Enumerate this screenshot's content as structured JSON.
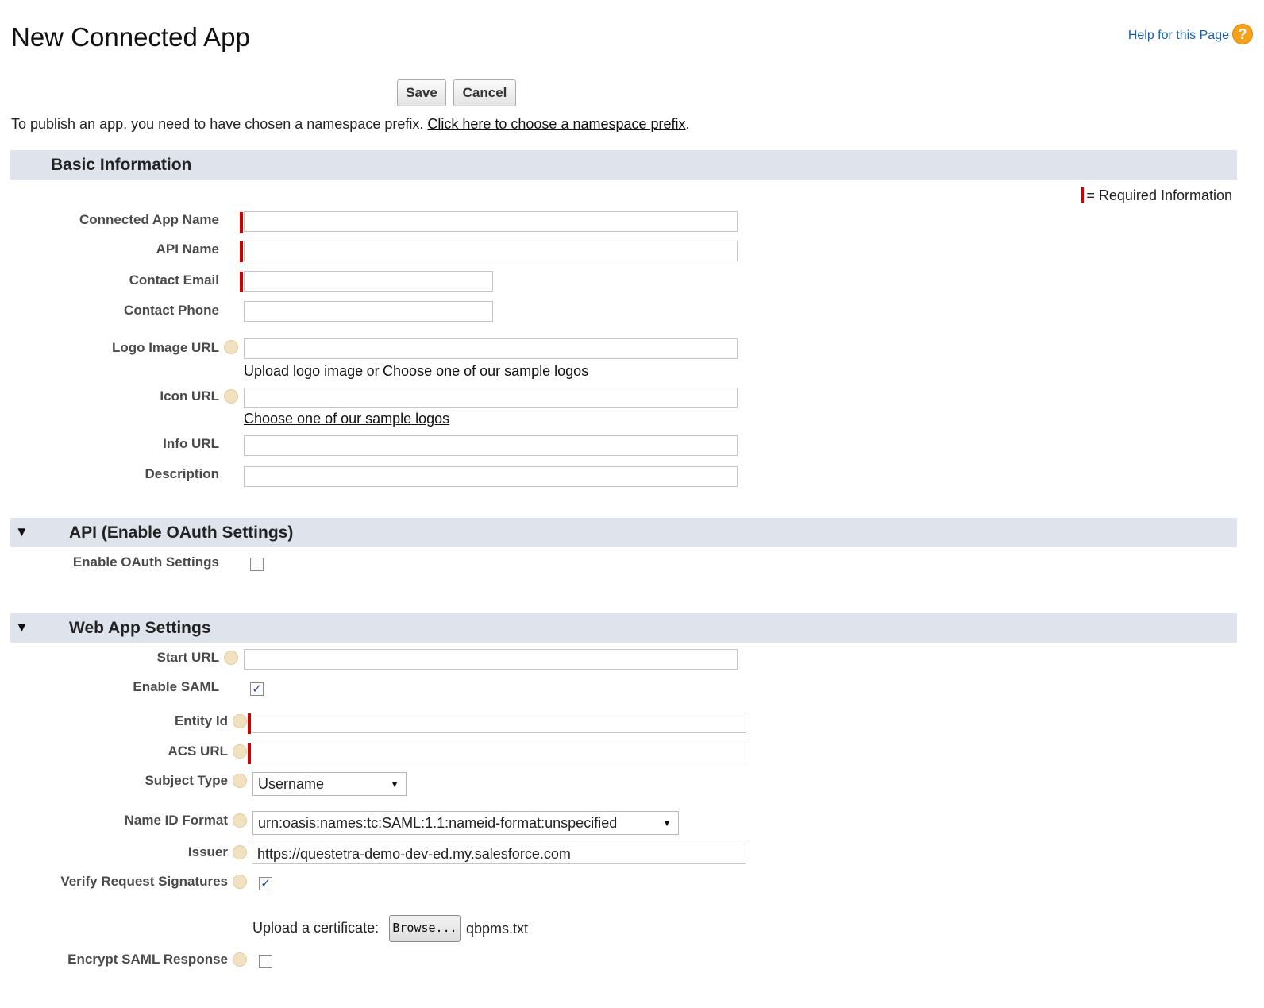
{
  "page": {
    "title": "New Connected App",
    "help_link": "Help for this Page",
    "help_icon": "?"
  },
  "toolbar": {
    "save": "Save",
    "cancel": "Cancel"
  },
  "notice": {
    "text": "To publish an app, you need to have chosen a namespace prefix. ",
    "link": "Click here to choose a namespace prefix",
    "end": "."
  },
  "basic": {
    "title": "Basic Information",
    "required_note": "= Required Information",
    "fields": {
      "connected_app_name": "Connected App Name",
      "api_name": "API Name",
      "contact_email": "Contact Email",
      "contact_phone": "Contact Phone",
      "logo_image_url": "Logo Image URL",
      "icon_url": "Icon URL",
      "info_url": "Info URL",
      "description": "Description"
    },
    "logo_upload_link": "Upload logo image",
    "logo_or": "or",
    "logo_sample_link": "Choose one of our sample logos",
    "icon_sample_link": "Choose one of our sample logos"
  },
  "api": {
    "title": "API (Enable OAuth Settings)",
    "enable_oauth_label": "Enable OAuth Settings",
    "enable_oauth_checked": false
  },
  "webapp": {
    "title": "Web App Settings",
    "start_url_label": "Start URL",
    "enable_saml_label": "Enable SAML",
    "enable_saml_checked": true,
    "entity_id_label": "Entity Id",
    "acs_url_label": "ACS URL",
    "subject_type_label": "Subject Type",
    "subject_type_value": "Username",
    "name_id_format_label": "Name ID Format",
    "name_id_format_value": "urn:oasis:names:tc:SAML:1.1:nameid-format:unspecified",
    "issuer_label": "Issuer",
    "issuer_value": "https://questetra-demo-dev-ed.my.salesforce.com",
    "verify_label": "Verify Request Signatures",
    "verify_checked": true,
    "upload_cert_label": "Upload a certificate:",
    "browse_label": "Browse...",
    "cert_filename": "qbpms.txt",
    "encrypt_label": "Encrypt SAML Response",
    "encrypt_checked": false
  },
  "icons": {
    "collapse": "triangle-down-icon",
    "info": "info-icon",
    "help": "help-icon",
    "check": "✓",
    "dropdown": "▼",
    "triangle": "▼"
  }
}
